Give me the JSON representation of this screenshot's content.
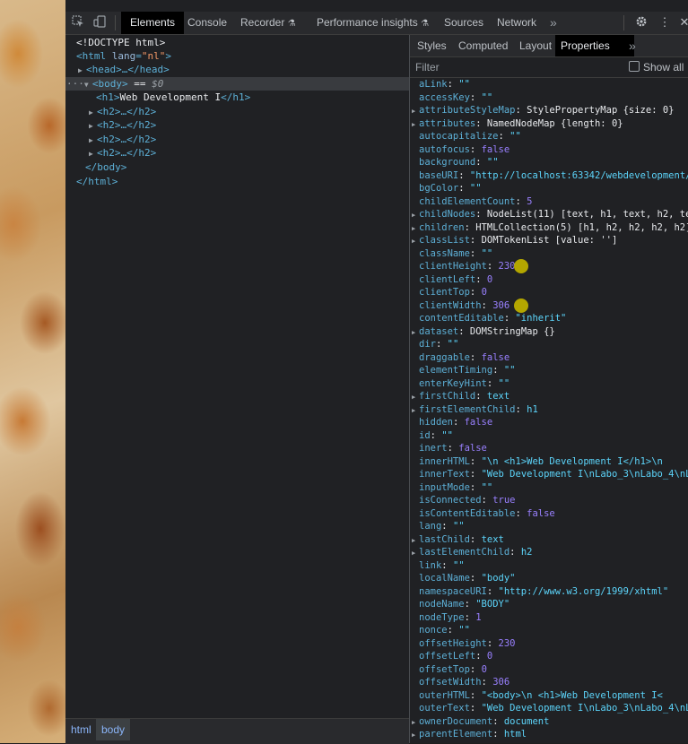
{
  "toolbar": {
    "tabs": [
      "Elements",
      "Console",
      "Recorder",
      "Performance insights",
      "Sources",
      "Network"
    ],
    "active_tab": "Elements",
    "icons": [
      "inspect-icon",
      "device-toolbar-icon",
      "settings-icon",
      "more-vert-icon",
      "close-icon"
    ]
  },
  "elements": {
    "doctype": "<!DOCTYPE html>",
    "html_open": "<html",
    "html_attr_name": "lang",
    "html_attr_value": "\"nl\"",
    "html_close_bracket": ">",
    "head": "<head>…</head>",
    "body_open": "<body>",
    "body_eq": " == ",
    "body_dollar": "$0",
    "h1_open": "<h1>",
    "h1_text": "Web Development I",
    "h1_close": "</h1>",
    "h2_collapsed": "<h2>…</h2>",
    "body_close": "</body>",
    "html_close": "</html>",
    "dots": "···"
  },
  "breadcrumbs": [
    "html",
    "body"
  ],
  "sidebar": {
    "tabs": [
      "Styles",
      "Computed",
      "Layout",
      "Properties"
    ],
    "active_tab": "Properties",
    "filter_placeholder": "Filter",
    "show_all_label": "Show all"
  },
  "properties": [
    {
      "name": "aLink",
      "value": "\"\"",
      "kind": "str",
      "expand": false
    },
    {
      "name": "accessKey",
      "value": "\"\"",
      "kind": "str",
      "expand": false
    },
    {
      "name": "attributeStyleMap",
      "value": "StylePropertyMap {size: 0}",
      "kind": "obj",
      "expand": true
    },
    {
      "name": "attributes",
      "value": "NamedNodeMap {length: 0}",
      "kind": "obj",
      "expand": true
    },
    {
      "name": "autocapitalize",
      "value": "\"\"",
      "kind": "str",
      "expand": false
    },
    {
      "name": "autofocus",
      "value": "false",
      "kind": "kw",
      "expand": false
    },
    {
      "name": "background",
      "value": "\"\"",
      "kind": "str",
      "expand": false
    },
    {
      "name": "baseURI",
      "value": "\"http://localhost:63342/webdevelopment/in",
      "kind": "str",
      "expand": false
    },
    {
      "name": "bgColor",
      "value": "\"\"",
      "kind": "str",
      "expand": false
    },
    {
      "name": "childElementCount",
      "value": "5",
      "kind": "num",
      "expand": false
    },
    {
      "name": "childNodes",
      "value": "NodeList(11) [text, h1, text, h2, text",
      "kind": "obj",
      "expand": true
    },
    {
      "name": "children",
      "value": "HTMLCollection(5) [h1, h2, h2, h2, h2]",
      "kind": "obj",
      "expand": true
    },
    {
      "name": "classList",
      "value": "DOMTokenList [value: '']",
      "kind": "obj",
      "expand": true
    },
    {
      "name": "className",
      "value": "\"\"",
      "kind": "str",
      "expand": false
    },
    {
      "name": "clientHeight",
      "value": "230",
      "kind": "num",
      "expand": false
    },
    {
      "name": "clientLeft",
      "value": "0",
      "kind": "num",
      "expand": false
    },
    {
      "name": "clientTop",
      "value": "0",
      "kind": "num",
      "expand": false
    },
    {
      "name": "clientWidth",
      "value": "306",
      "kind": "num",
      "expand": false
    },
    {
      "name": "contentEditable",
      "value": "\"inherit\"",
      "kind": "str",
      "expand": false
    },
    {
      "name": "dataset",
      "value": "DOMStringMap {}",
      "kind": "obj",
      "expand": true
    },
    {
      "name": "dir",
      "value": "\"\"",
      "kind": "str",
      "expand": false
    },
    {
      "name": "draggable",
      "value": "false",
      "kind": "kw",
      "expand": false
    },
    {
      "name": "elementTiming",
      "value": "\"\"",
      "kind": "str",
      "expand": false
    },
    {
      "name": "enterKeyHint",
      "value": "\"\"",
      "kind": "str",
      "expand": false
    },
    {
      "name": "firstChild",
      "value": "text",
      "kind": "str",
      "expand": true
    },
    {
      "name": "firstElementChild",
      "value": "h1",
      "kind": "str",
      "expand": true
    },
    {
      "name": "hidden",
      "value": "false",
      "kind": "kw",
      "expand": false
    },
    {
      "name": "id",
      "value": "\"\"",
      "kind": "str",
      "expand": false
    },
    {
      "name": "inert",
      "value": "false",
      "kind": "kw",
      "expand": false
    },
    {
      "name": "innerHTML",
      "value": "\"\\n        <h1>Web Development I</h1>\\n",
      "kind": "str",
      "expand": false
    },
    {
      "name": "innerText",
      "value": "\"Web Development I\\nLabo_3\\nLabo_4\\nLab",
      "kind": "str",
      "expand": false
    },
    {
      "name": "inputMode",
      "value": "\"\"",
      "kind": "str",
      "expand": false
    },
    {
      "name": "isConnected",
      "value": "true",
      "kind": "kw",
      "expand": false
    },
    {
      "name": "isContentEditable",
      "value": "false",
      "kind": "kw",
      "expand": false
    },
    {
      "name": "lang",
      "value": "\"\"",
      "kind": "str",
      "expand": false
    },
    {
      "name": "lastChild",
      "value": "text",
      "kind": "str",
      "expand": true
    },
    {
      "name": "lastElementChild",
      "value": "h2",
      "kind": "str",
      "expand": true
    },
    {
      "name": "link",
      "value": "\"\"",
      "kind": "str",
      "expand": false
    },
    {
      "name": "localName",
      "value": "\"body\"",
      "kind": "str",
      "expand": false
    },
    {
      "name": "namespaceURI",
      "value": "\"http://www.w3.org/1999/xhtml\"",
      "kind": "str",
      "expand": false
    },
    {
      "name": "nodeName",
      "value": "\"BODY\"",
      "kind": "str",
      "expand": false
    },
    {
      "name": "nodeType",
      "value": "1",
      "kind": "num",
      "expand": false
    },
    {
      "name": "nonce",
      "value": "\"\"",
      "kind": "str",
      "expand": false
    },
    {
      "name": "offsetHeight",
      "value": "230",
      "kind": "num",
      "expand": false
    },
    {
      "name": "offsetLeft",
      "value": "0",
      "kind": "num",
      "expand": false
    },
    {
      "name": "offsetTop",
      "value": "0",
      "kind": "num",
      "expand": false
    },
    {
      "name": "offsetWidth",
      "value": "306",
      "kind": "num",
      "expand": false
    },
    {
      "name": "outerHTML",
      "value": "\"<body>\\n        <h1>Web Development I<",
      "kind": "str",
      "expand": false
    },
    {
      "name": "outerText",
      "value": "\"Web Development I\\nLabo_3\\nLabo_4\\nLab",
      "kind": "str",
      "expand": false
    },
    {
      "name": "ownerDocument",
      "value": "document",
      "kind": "str",
      "expand": true
    },
    {
      "name": "parentElement",
      "value": "html",
      "kind": "str",
      "expand": true
    }
  ],
  "marker_color": "#b3a600"
}
